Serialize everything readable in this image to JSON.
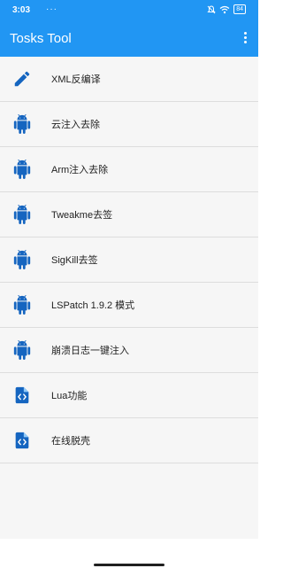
{
  "status_bar": {
    "time": "3:03",
    "dots": "···",
    "battery": "84"
  },
  "toolbar": {
    "title": "Tosks Tool"
  },
  "items": [
    {
      "label": "XML反编译",
      "icon": "pencil-icon"
    },
    {
      "label": "云注入去除",
      "icon": "android-icon"
    },
    {
      "label": "Arm注入去除",
      "icon": "android-icon"
    },
    {
      "label": "Tweakme去签",
      "icon": "android-icon"
    },
    {
      "label": "SigKill去签",
      "icon": "android-icon"
    },
    {
      "label": "LSPatch 1.9.2 模式",
      "icon": "android-icon"
    },
    {
      "label": "崩溃日志一键注入",
      "icon": "android-icon"
    },
    {
      "label": "Lua功能",
      "icon": "code-file-icon"
    },
    {
      "label": "在线脱壳",
      "icon": "code-file-icon"
    }
  ],
  "colors": {
    "primary": "#2196f3",
    "icon": "#1565c0"
  }
}
